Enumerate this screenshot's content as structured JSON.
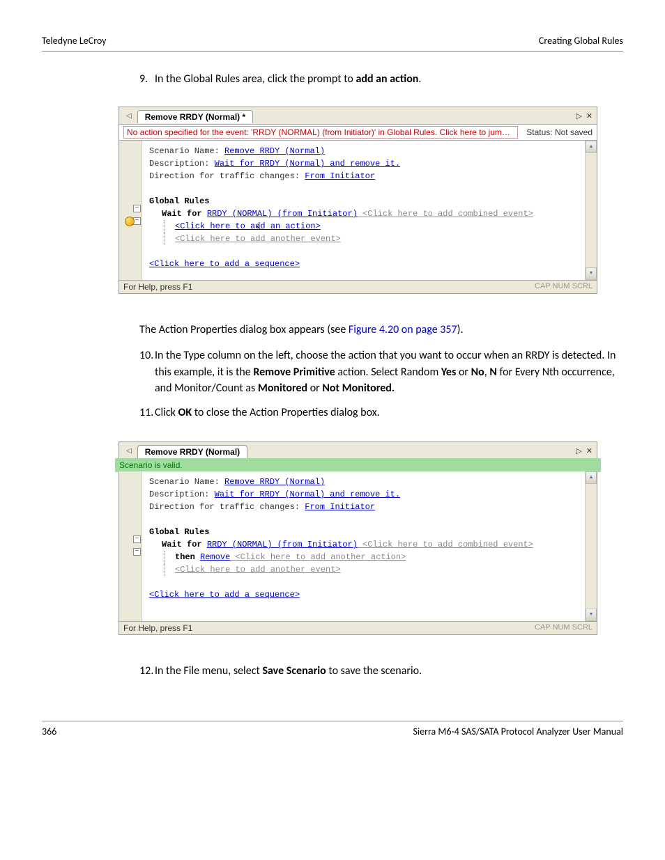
{
  "header": {
    "left": "Teledyne LeCroy",
    "right": "Creating Global Rules"
  },
  "step9": {
    "num": "9.",
    "text_pre": "In the Global Rules area, click the prompt to ",
    "text_bold": "add an action",
    "text_post": "."
  },
  "fig1": {
    "tab_title": "Remove RRDY (Normal) *",
    "warning": "No action specified for the event: 'RRDY (NORMAL) (from Initiator)' in Global Rules.  Click here to jump to the p...",
    "status_right": "Status: Not saved",
    "scenario_label": "Scenario Name: ",
    "scenario_value": "Remove RRDY (Normal)",
    "desc_label": "Description: ",
    "desc_value": "Wait for RRDY (Normal) and remove it.",
    "dir_label": "Direction for traffic changes: ",
    "dir_value": "From Initiator",
    "global_rules": "Global Rules",
    "waitfor_kw": "Wait for ",
    "waitfor_lnk": "RRDY (NORMAL) (from Initiator)",
    "waitfor_ph": " <Click here to add combined event>",
    "add_action": "<Click here to add an action>",
    "add_event": "<Click here to add another event>",
    "add_seq": "<Click here to add a sequence>",
    "help": "For Help, press F1",
    "caps": "CAP NUM SCRL"
  },
  "mid_para_pre": "The Action Properties dialog box appears (see ",
  "mid_para_link": "Figure 4.20 on page 357",
  "mid_para_post": ").",
  "step10": {
    "num": "10.",
    "pre": "In the Type column on the left, choose the action that you want to occur when an RRDY is detected. In this example, it is the ",
    "b1": "Remove Primitive",
    "mid1": " action. Select Random ",
    "b2": "Yes",
    "mid2": " or ",
    "b3": "No",
    "mid3": ", ",
    "b4": "N",
    "mid4": " for Every Nth occurrence, and Monitor/Count as ",
    "b5": "Monitored",
    "mid5": " or ",
    "b6": "Not Monitored."
  },
  "step11": {
    "num": "11.",
    "pre": "Click ",
    "b1": "OK",
    "post": " to close the Action Properties dialog box."
  },
  "fig2": {
    "tab_title": "Remove RRDY (Normal)",
    "valid_msg": "Scenario is valid.",
    "then_kw": "then ",
    "then_lnk": "Remove",
    "then_ph": " <Click here to add another action>"
  },
  "step12": {
    "num": "12.",
    "pre": "In the File menu, select ",
    "b1": "Save Scenario",
    "post": " to save the scenario."
  },
  "footer": {
    "page": "366",
    "manual": "Sierra M6-4 SAS/SATA Protocol Analyzer User Manual"
  }
}
